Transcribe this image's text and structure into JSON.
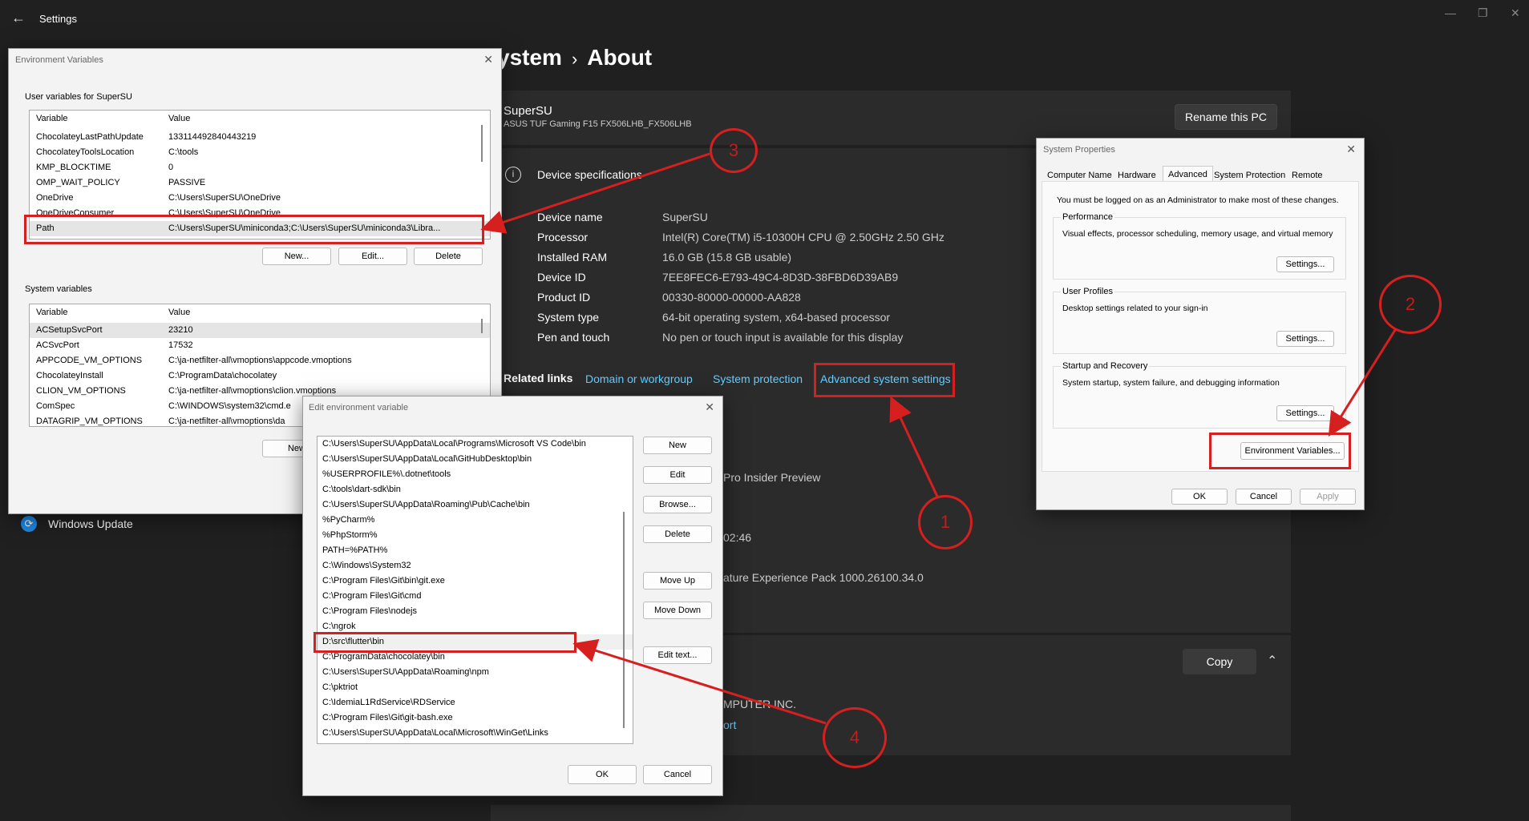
{
  "window": {
    "back_glyph": "←",
    "title": "Settings",
    "minimize_glyph": "—",
    "restore_glyph": "❐",
    "close_glyph": "✕"
  },
  "breadcrumb": {
    "parent": "ystem",
    "sep": "›",
    "current": "About"
  },
  "device": {
    "name": "SuperSU",
    "model": "ASUS TUF Gaming F15 FX506LHB_FX506LHB",
    "rename_label": "Rename this PC"
  },
  "specs": {
    "title": "Device specifications",
    "rows": [
      {
        "label": "Device name",
        "value": "SuperSU"
      },
      {
        "label": "Processor",
        "value": "Intel(R) Core(TM) i5-10300H CPU @ 2.50GHz   2.50 GHz"
      },
      {
        "label": "Installed RAM",
        "value": "16.0 GB (15.8 GB usable)"
      },
      {
        "label": "Device ID",
        "value": "7EE8FEC6-E793-49C4-8D3D-38FBD6D39AB9"
      },
      {
        "label": "Product ID",
        "value": "00330-80000-00000-AA828"
      },
      {
        "label": "System type",
        "value": "64-bit operating system, x64-based processor"
      },
      {
        "label": "Pen and touch",
        "value": "No pen or touch input is available for this display"
      }
    ]
  },
  "related": {
    "label": "Related links",
    "links": [
      "Domain or workgroup",
      "System protection",
      "Advanced system settings"
    ]
  },
  "winspec": {
    "edition_frag": "Pro Insider Preview",
    "time_frag": "02:46",
    "experience_frag": "ature Experience Pack 1000.26100.34.0",
    "copy_label": "Copy",
    "chevron_glyph": "⌃",
    "maker_frag": "MPUTER INC.",
    "support_frag": "ort"
  },
  "sidebar": {
    "windows_update": "Windows Update",
    "update_glyph": "⟳"
  },
  "env_dialog": {
    "title": "Environment Variables",
    "close_glyph": "✕",
    "user_group": "User variables for SuperSU",
    "col_variable": "Variable",
    "col_value": "Value",
    "user_vars": [
      {
        "name": "ChocolateyLastPathUpdate",
        "value": "133114492840443219"
      },
      {
        "name": "ChocolateyToolsLocation",
        "value": "C:\\tools"
      },
      {
        "name": "KMP_BLOCKTIME",
        "value": "0"
      },
      {
        "name": "OMP_WAIT_POLICY",
        "value": "PASSIVE"
      },
      {
        "name": "OneDrive",
        "value": "C:\\Users\\SuperSU\\OneDrive"
      },
      {
        "name": "OneDriveConsumer",
        "value": "C:\\Users\\SuperSU\\OneDrive"
      },
      {
        "name": "Path",
        "value": "C:\\Users\\SuperSU\\miniconda3;C:\\Users\\SuperSU\\miniconda3\\Libra..."
      }
    ],
    "user_buttons": [
      "New...",
      "Edit...",
      "Delete"
    ],
    "system_group": "System variables",
    "system_vars": [
      {
        "name": "ACSetupSvcPort",
        "value": "23210"
      },
      {
        "name": "ACSvcPort",
        "value": "17532"
      },
      {
        "name": "APPCODE_VM_OPTIONS",
        "value": "C:\\ja-netfilter-all\\vmoptions\\appcode.vmoptions"
      },
      {
        "name": "ChocolateyInstall",
        "value": "C:\\ProgramData\\chocolatey"
      },
      {
        "name": "CLION_VM_OPTIONS",
        "value": "C:\\ja-netfilter-all\\vmoptions\\clion.vmoptions"
      },
      {
        "name": "ComSpec",
        "value": "C:\\WINDOWS\\system32\\cmd.e"
      },
      {
        "name": "DATAGRIP_VM_OPTIONS",
        "value": "C:\\ja-netfilter-all\\vmoptions\\da"
      }
    ],
    "system_new": "New"
  },
  "edit_dialog": {
    "title": "Edit environment variable",
    "close_glyph": "✕",
    "entries": [
      "C:\\Users\\SuperSU\\AppData\\Local\\Programs\\Microsoft VS Code\\bin",
      "C:\\Users\\SuperSU\\AppData\\Local\\GitHubDesktop\\bin",
      "%USERPROFILE%\\.dotnet\\tools",
      "C:\\tools\\dart-sdk\\bin",
      "C:\\Users\\SuperSU\\AppData\\Roaming\\Pub\\Cache\\bin",
      "%PyCharm%",
      "%PhpStorm%",
      "PATH=%PATH%",
      "C:\\Windows\\System32",
      "C:\\Program Files\\Git\\bin\\git.exe",
      "C:\\Program Files\\Git\\cmd",
      "C:\\Program Files\\nodejs",
      "C:\\ngrok",
      "D:\\src\\flutter\\bin",
      "C:\\ProgramData\\chocolatey\\bin",
      "C:\\Users\\SuperSU\\AppData\\Roaming\\npm",
      "C:\\pktriot",
      "C:\\IdemiaL1RdService\\RDService",
      "C:\\Program Files\\Git\\git-bash.exe",
      "C:\\Users\\SuperSU\\AppData\\Local\\Microsoft\\WinGet\\Links"
    ],
    "buttons": [
      "New",
      "Edit",
      "Browse...",
      "Delete",
      "Move Up",
      "Move Down",
      "Edit text..."
    ],
    "ok": "OK",
    "cancel": "Cancel"
  },
  "sysprops": {
    "title": "System Properties",
    "close_glyph": "✕",
    "tabs": [
      "Computer Name",
      "Hardware",
      "Advanced",
      "System Protection",
      "Remote"
    ],
    "active_tab": "Advanced",
    "admin_note": "You must be logged on as an Administrator to make most of these changes.",
    "sections": [
      {
        "title": "Performance",
        "desc": "Visual effects, processor scheduling, memory usage, and virtual memory",
        "button": "Settings..."
      },
      {
        "title": "User Profiles",
        "desc": "Desktop settings related to your sign-in",
        "button": "Settings..."
      },
      {
        "title": "Startup and Recovery",
        "desc": "System startup, system failure, and debugging information",
        "button": "Settings..."
      }
    ],
    "env_button": "Environment Variables...",
    "ok": "OK",
    "cancel": "Cancel",
    "apply": "Apply"
  },
  "annotations": [
    "1",
    "2",
    "3",
    "4"
  ],
  "colors": {
    "annotation_red": "#d62020",
    "link_blue": "#60cdff",
    "dark_bg": "#202020"
  }
}
